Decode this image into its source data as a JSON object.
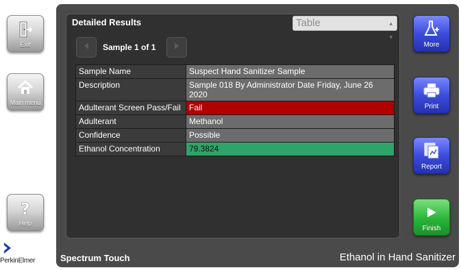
{
  "sidebar_left": {
    "exit_label": "Exit",
    "main_menu_label": "Main menu",
    "help_label": "Help"
  },
  "brand": {
    "logo_text": "PerkinElmer",
    "logo_color": "#1a3d9c"
  },
  "panel": {
    "title": "Detailed Results",
    "view_selected": "Table",
    "sample_counter": "Sample 1 of 1"
  },
  "results": [
    {
      "key": "Sample Name",
      "value": "Suspect Hand Sanitizer Sample"
    },
    {
      "key": "Description",
      "value": "Sample 018 By Administrator Date Friday, June 26 2020"
    },
    {
      "key": "Adulterant Screen Pass/Fail",
      "value": "Fail"
    },
    {
      "key": "Adulterant",
      "value": "Methanol"
    },
    {
      "key": "Confidence",
      "value": "Possible"
    },
    {
      "key": "Ethanol Concentration",
      "value": "79.3824"
    }
  ],
  "footer": {
    "app_name": "Spectrum Touch",
    "method_name": "Ethanol in Hand Sanitizer"
  },
  "sidebar_right": {
    "more_label": "More",
    "print_label": "Print",
    "report_label": "Report",
    "finish_label": "Finish"
  },
  "colors": {
    "fail": "#b00000",
    "pass_value": "#2fa46a",
    "button_blue": "#3c4ddc",
    "button_green": "#2ab53a"
  },
  "icons": {
    "exit": "exit-door-icon",
    "main_menu": "home-icon",
    "help": "question-mark-icon",
    "more": "flask-plus-icon",
    "print": "printer-icon",
    "report": "report-pages-icon",
    "finish": "play-arrow-icon",
    "prev": "arrow-left-icon",
    "next": "arrow-right-icon"
  }
}
